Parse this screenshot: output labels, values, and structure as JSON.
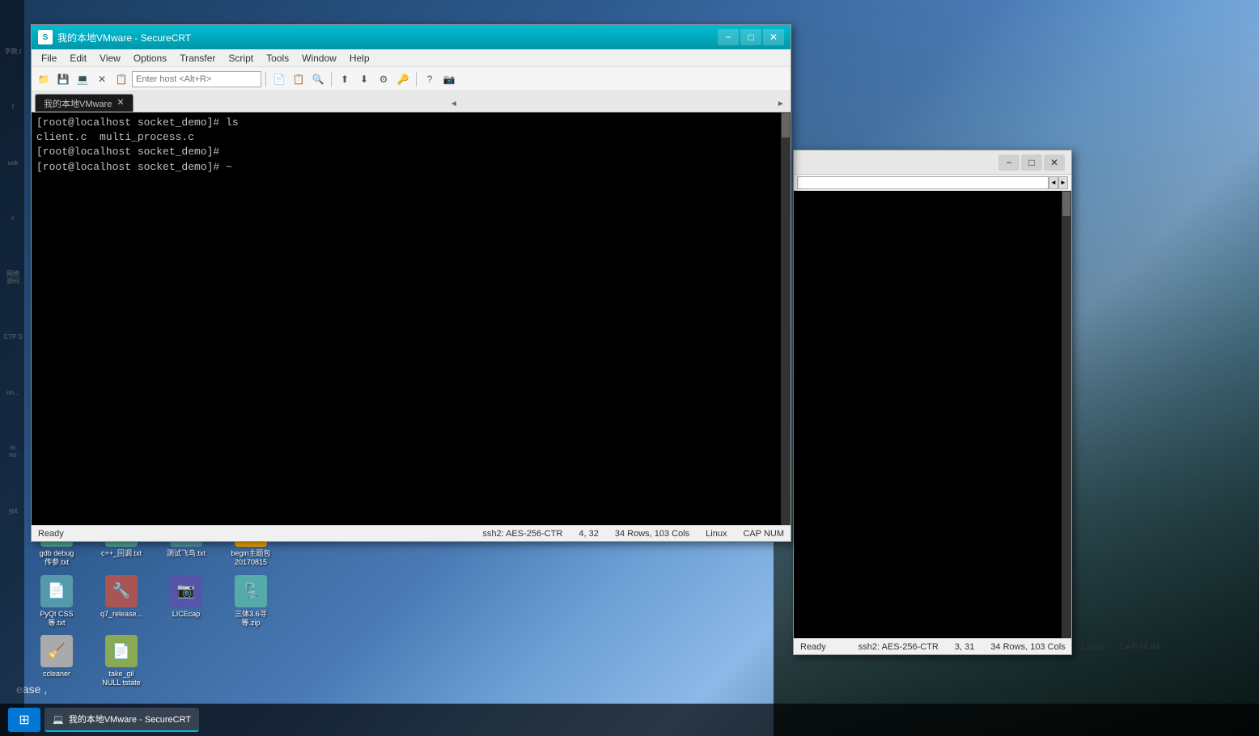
{
  "app": {
    "title": "我的本地VMware - SecureCRT",
    "tab_label": "我的本地VMware",
    "icon_char": "S"
  },
  "menu": {
    "items": [
      "File",
      "Edit",
      "View",
      "Options",
      "Transfer",
      "Script",
      "Tools",
      "Window",
      "Help"
    ]
  },
  "toolbar": {
    "host_placeholder": "Enter host <Alt+R>"
  },
  "terminal": {
    "lines": [
      "[root@localhost socket_demo]# ls",
      "client.c  multi_process.c",
      "[root@localhost socket_demo]#",
      "[root@localhost socket_demo]# ~"
    ]
  },
  "status_bar": {
    "ready": "Ready",
    "encryption": "ssh2: AES-256-CTR",
    "position": "4, 32",
    "dimensions": "34 Rows, 103 Cols",
    "os": "Linux",
    "caps": "CAP NUM"
  },
  "second_window": {
    "status": {
      "ready": "Ready",
      "encryption": "ssh2: AES-256-CTR",
      "position": "3, 31",
      "dimensions": "34 Rows, 103 Cols",
      "os": "Linux",
      "caps": "CAP NUM"
    }
  },
  "desktop_icons": [
    {
      "label": "gdb debug 传参.txt",
      "icon": "📄",
      "color": "#5a9"
    },
    {
      "label": "c++_回调.txt",
      "icon": "📄",
      "color": "#5a9"
    },
    {
      "label": "测试飞鸟.txt",
      "icon": "📄",
      "color": "#59a"
    },
    {
      "label": "begin主题包 20170815",
      "icon": "📦",
      "color": "#fa0"
    },
    {
      "label": "PyQt CSS等.txt",
      "icon": "📄",
      "color": "#59a"
    },
    {
      "label": "q7_release...",
      "icon": "🔧",
      "color": "#a55"
    },
    {
      "label": "LICEcap",
      "icon": "📷",
      "color": "#55a"
    },
    {
      "label": "三体3.6寻等.zip",
      "icon": "🗜️",
      "color": "#5aa"
    },
    {
      "label": "ccleaner",
      "icon": "🧹",
      "color": "#aaa"
    },
    {
      "label": "take_gil NULL tstate",
      "icon": "📄",
      "color": "#8a5"
    }
  ],
  "left_labels": [
    "字数.t",
    "f",
    "ook",
    "c",
    "网络源码",
    "CTP S",
    "lnn...",
    "m\nrer",
    "ypt"
  ]
}
